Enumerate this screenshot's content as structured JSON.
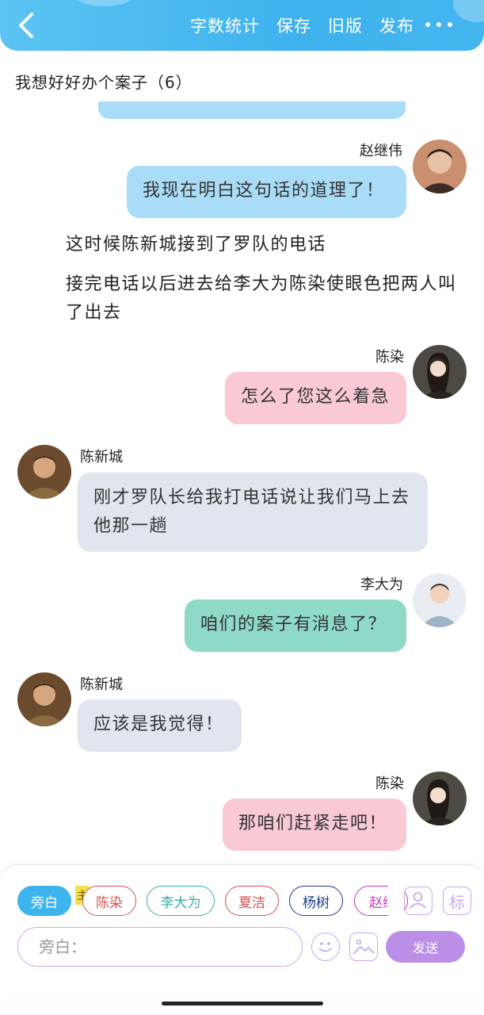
{
  "header": {
    "actions": [
      "字数统计",
      "保存",
      "旧版",
      "发布"
    ]
  },
  "document": {
    "title": "我想好好办个案子（6）"
  },
  "messages": [
    {
      "speaker": "赵继伟",
      "text": "我现在明白这句话的道理了！",
      "side": "right",
      "color": "#a9dcf7"
    },
    {
      "narration": "这时候陈新城接到了罗队的电话"
    },
    {
      "narration": "接完电话以后进去给李大为陈染使眼色把两人叫了出去"
    },
    {
      "speaker": "陈染",
      "text": "怎么了您这么着急",
      "side": "right",
      "color": "#f9c9d4"
    },
    {
      "speaker": "陈新城",
      "text": "刚才罗队长给我打电话说让我们马上去他那一趟",
      "side": "left",
      "color": "#e1e5ee"
    },
    {
      "speaker": "李大为",
      "text": "咱们的案子有消息了？",
      "side": "right",
      "color": "#8fd9c9"
    },
    {
      "speaker": "陈新城",
      "text": "应该是我觉得！",
      "side": "left",
      "color": "#e1e5ee"
    },
    {
      "speaker": "陈染",
      "text": "那咱们赶紧走吧！",
      "side": "right",
      "color": "#f9c9d4"
    }
  ],
  "input_bar": {
    "characters": [
      {
        "label": "旁白",
        "color": "#3db4ee",
        "active": true
      },
      {
        "label": "陈染",
        "color": "#d9534f",
        "active": false
      },
      {
        "label": "李大为",
        "color": "#3aaea3",
        "active": false
      },
      {
        "label": "夏洁",
        "color": "#d9534f",
        "active": false
      },
      {
        "label": "杨树",
        "color": "#1f3a8a",
        "active": false
      },
      {
        "label": "赵继",
        "color": "#c040c0",
        "active": false
      }
    ],
    "main_tag": "主",
    "tag_label": "标",
    "placeholder": "旁白：",
    "send_label": "发送"
  }
}
